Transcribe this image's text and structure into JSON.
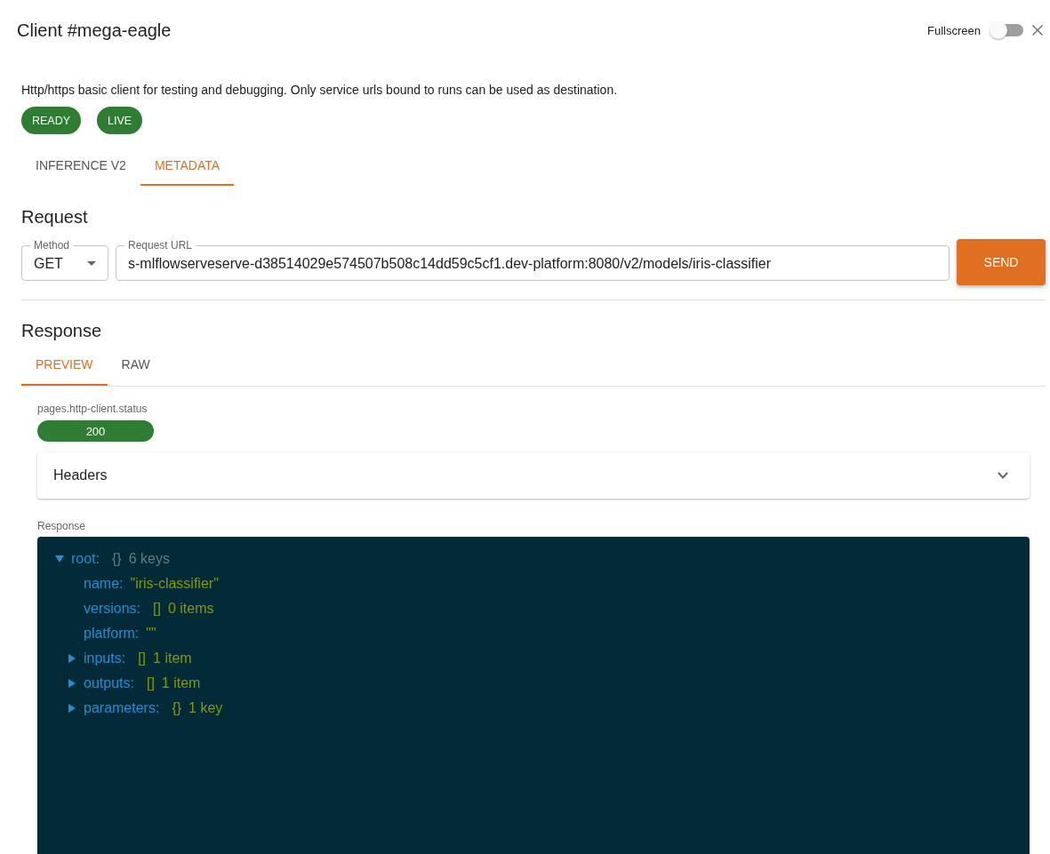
{
  "header": {
    "title": "Client #mega-eagle",
    "fullscreen": {
      "label": "Fullscreen",
      "on": false
    }
  },
  "description": "Http/https basic client for testing and debugging. Only service urls bound to runs can be used as destination.",
  "badges": [
    "READY",
    "LIVE"
  ],
  "tabs": [
    {
      "label": "INFERENCE V2",
      "selected": false
    },
    {
      "label": "METADATA",
      "selected": true
    }
  ],
  "request": {
    "heading": "Request",
    "method": {
      "label": "Method",
      "value": "GET"
    },
    "url": {
      "label": "Request URL",
      "value": "s-mlflowserveserve-d38514029e574507b508c14dd59c5cf1.dev-platform:8080/v2/models/iris-classifier"
    },
    "send": "SEND"
  },
  "response": {
    "heading": "Response",
    "tabs": [
      {
        "label": "PREVIEW",
        "selected": true
      },
      {
        "label": "RAW",
        "selected": false
      }
    ],
    "status": {
      "label": "pages.http-client.status",
      "code": "200"
    },
    "headers": {
      "label": "Headers",
      "expanded": false
    },
    "body": {
      "label": "Response",
      "tree": {
        "key": "root:",
        "kind": "object",
        "expanded": true,
        "brackets": "{}",
        "summary": "6 keys",
        "children": [
          {
            "key": "name:",
            "kind": "string",
            "value": "\"iris-classifier\""
          },
          {
            "key": "versions:",
            "kind": "array",
            "brackets": "[]",
            "summary": "0 items"
          },
          {
            "key": "platform:",
            "kind": "string",
            "value": "\"\""
          },
          {
            "key": "inputs:",
            "kind": "array",
            "expanded": false,
            "brackets": "[]",
            "summary": "1 item"
          },
          {
            "key": "outputs:",
            "kind": "array",
            "expanded": false,
            "brackets": "[]",
            "summary": "1 item"
          },
          {
            "key": "parameters:",
            "kind": "object",
            "expanded": false,
            "brackets": "{}",
            "summary": "1 key"
          }
        ]
      }
    }
  }
}
